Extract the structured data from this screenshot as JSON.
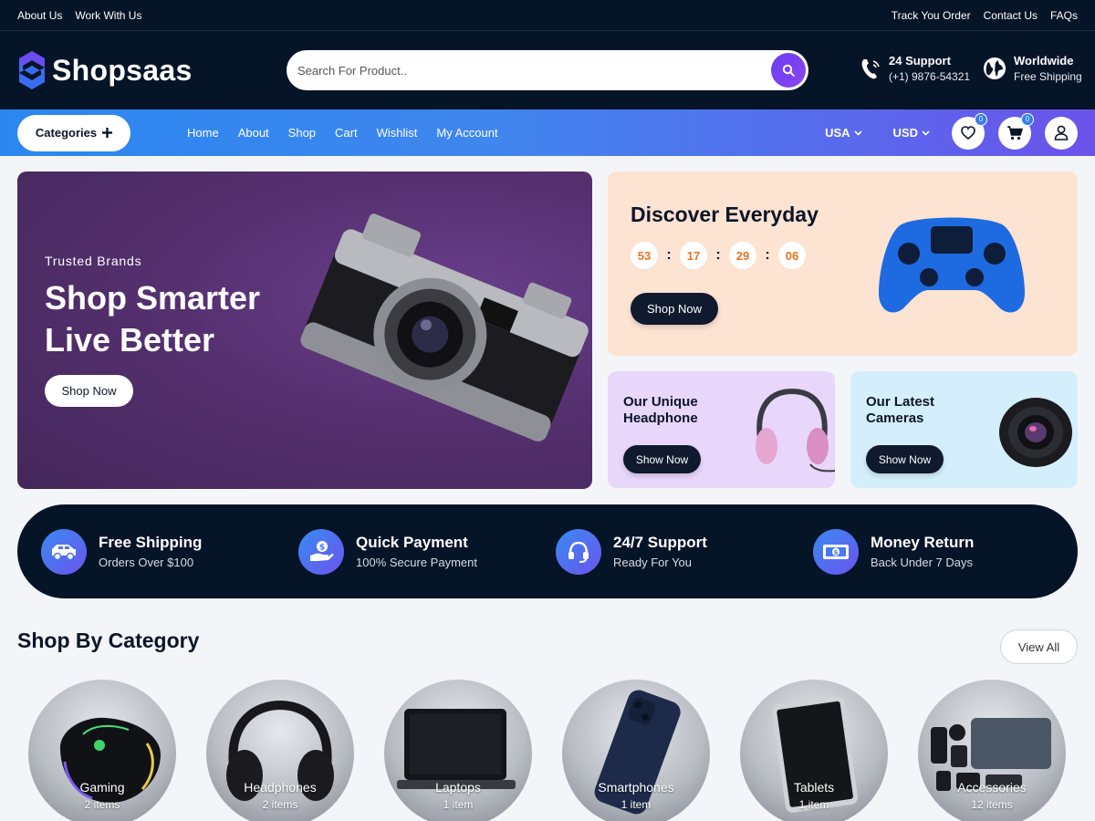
{
  "topbar": {
    "left_links": [
      "About Us",
      "Work With Us"
    ],
    "right_links": [
      "Track You Order",
      "Contact Us",
      "FAQs"
    ]
  },
  "header": {
    "logo_text": "Shopsaas",
    "search_placeholder": "Search For Product..",
    "support": {
      "title": "24 Support",
      "phone": "(+1) 9876-54321"
    },
    "shipping": {
      "title": "Worldwide",
      "subtitle": "Free Shipping"
    }
  },
  "nav": {
    "categories_label": "Categories",
    "links": [
      "Home",
      "About",
      "Shop",
      "Cart",
      "Wishlist",
      "My Account"
    ],
    "country": "USA",
    "currency": "USD",
    "wishlist_count": "0",
    "cart_count": "0"
  },
  "hero": {
    "subtitle": "Trusted Brands",
    "title": "Shop Smarter Live Better",
    "button": "Shop Now"
  },
  "promo_discover": {
    "title": "Discover Everyday",
    "timer": [
      "53",
      "17",
      "29",
      "06"
    ],
    "button": "Shop Now"
  },
  "promo_headphone": {
    "title": "Our Unique Headphone",
    "button": "Show Now"
  },
  "promo_cameras": {
    "title": "Our Latest Cameras",
    "button": "Show Now"
  },
  "features": [
    {
      "icon": "truck-icon",
      "title": "Free Shipping",
      "subtitle": "Orders Over $100"
    },
    {
      "icon": "payment-hand-icon",
      "title": "Quick Payment",
      "subtitle": "100% Secure Payment"
    },
    {
      "icon": "headset-icon",
      "title": "24/7 Support",
      "subtitle": "Ready For You"
    },
    {
      "icon": "money-icon",
      "title": "Money Return",
      "subtitle": "Back Under 7 Days"
    }
  ],
  "category_section": {
    "title": "Shop By Category",
    "view_all": "View All",
    "items": [
      {
        "name": "Gaming",
        "count": "2 items"
      },
      {
        "name": "Headphones",
        "count": "2 items"
      },
      {
        "name": "Laptops",
        "count": "1 item"
      },
      {
        "name": "Smartphones",
        "count": "1 item"
      },
      {
        "name": "Tablets",
        "count": "1 item"
      },
      {
        "name": "Accessories",
        "count": "12 items"
      }
    ]
  },
  "colors": {
    "dark_navy": "#061427",
    "accent_purple": "#6a3df0",
    "accent_blue": "#2b87f0",
    "timer_orange": "#e8721f"
  }
}
